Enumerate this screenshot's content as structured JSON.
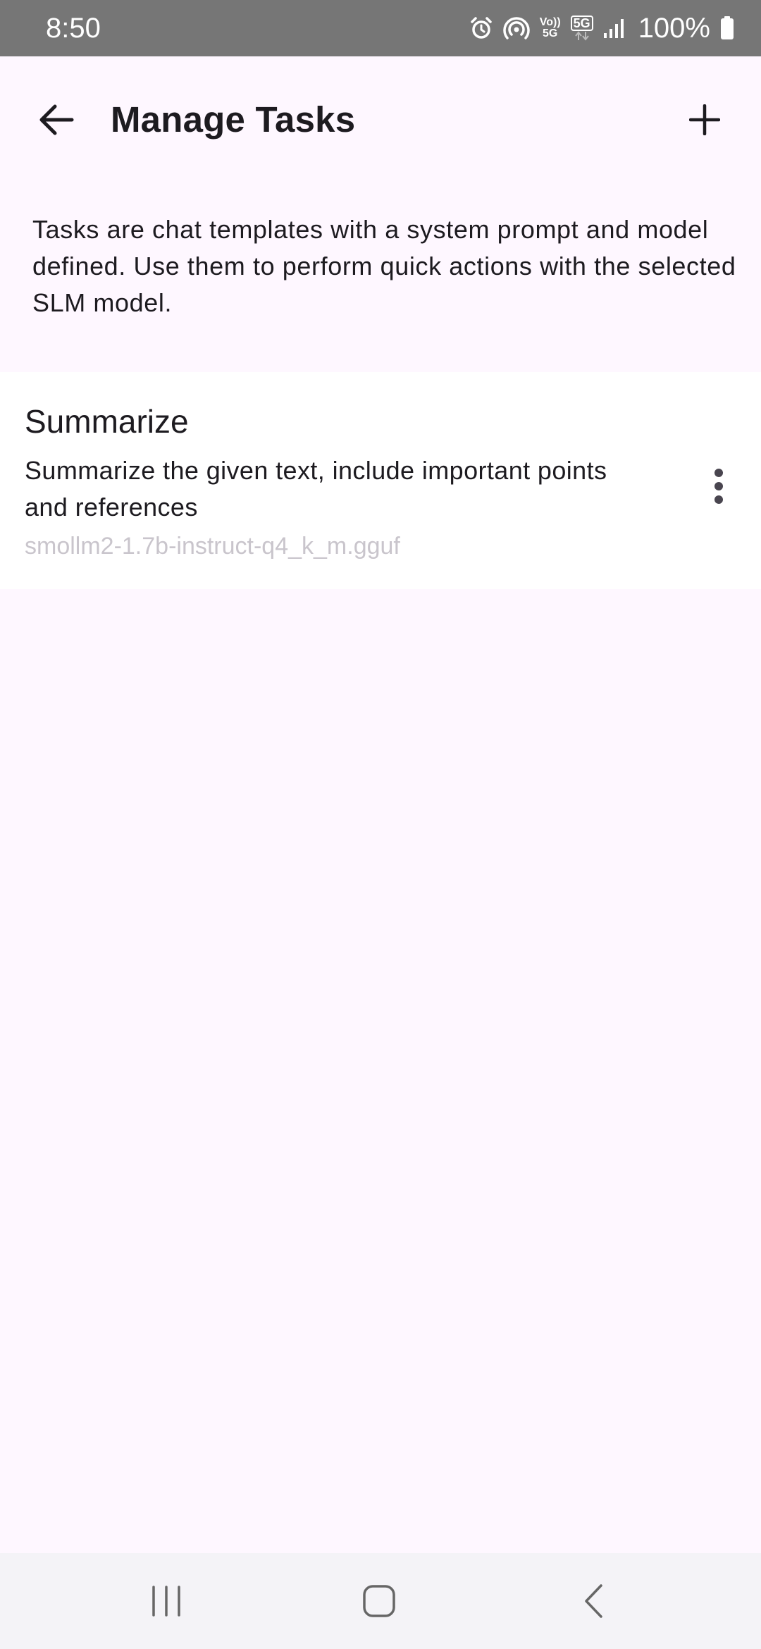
{
  "status_bar": {
    "time": "8:50",
    "icons": [
      "alarm-icon",
      "hotspot-icon",
      "volte-icon",
      "5g-icon",
      "signal-icon",
      "battery-icon"
    ],
    "volte_top": "Vo))",
    "volte_bottom": "5G",
    "network": "5G",
    "battery": "100%"
  },
  "app_bar": {
    "title": "Manage Tasks",
    "back_icon": "arrow-back-icon",
    "add_icon": "plus-icon"
  },
  "description": "Tasks are chat templates with a system prompt and model defined. Use them to perform quick actions with the selected SLM model.",
  "tasks": [
    {
      "name": "Summarize",
      "description": "Summarize the given text, include important points and references",
      "model": "smollm2-1.7b-instruct-q4_k_m.gguf",
      "menu_icon": "more-vert-icon"
    }
  ],
  "nav_bar": {
    "icons": [
      "recent-apps-icon",
      "home-icon",
      "back-icon"
    ]
  },
  "colors": {
    "background": "#FEF7FF",
    "card": "#FFFFFF",
    "status_bar": "#767676",
    "model_text": "#C9C5CC",
    "nav_bar": "#F4F3F7"
  }
}
